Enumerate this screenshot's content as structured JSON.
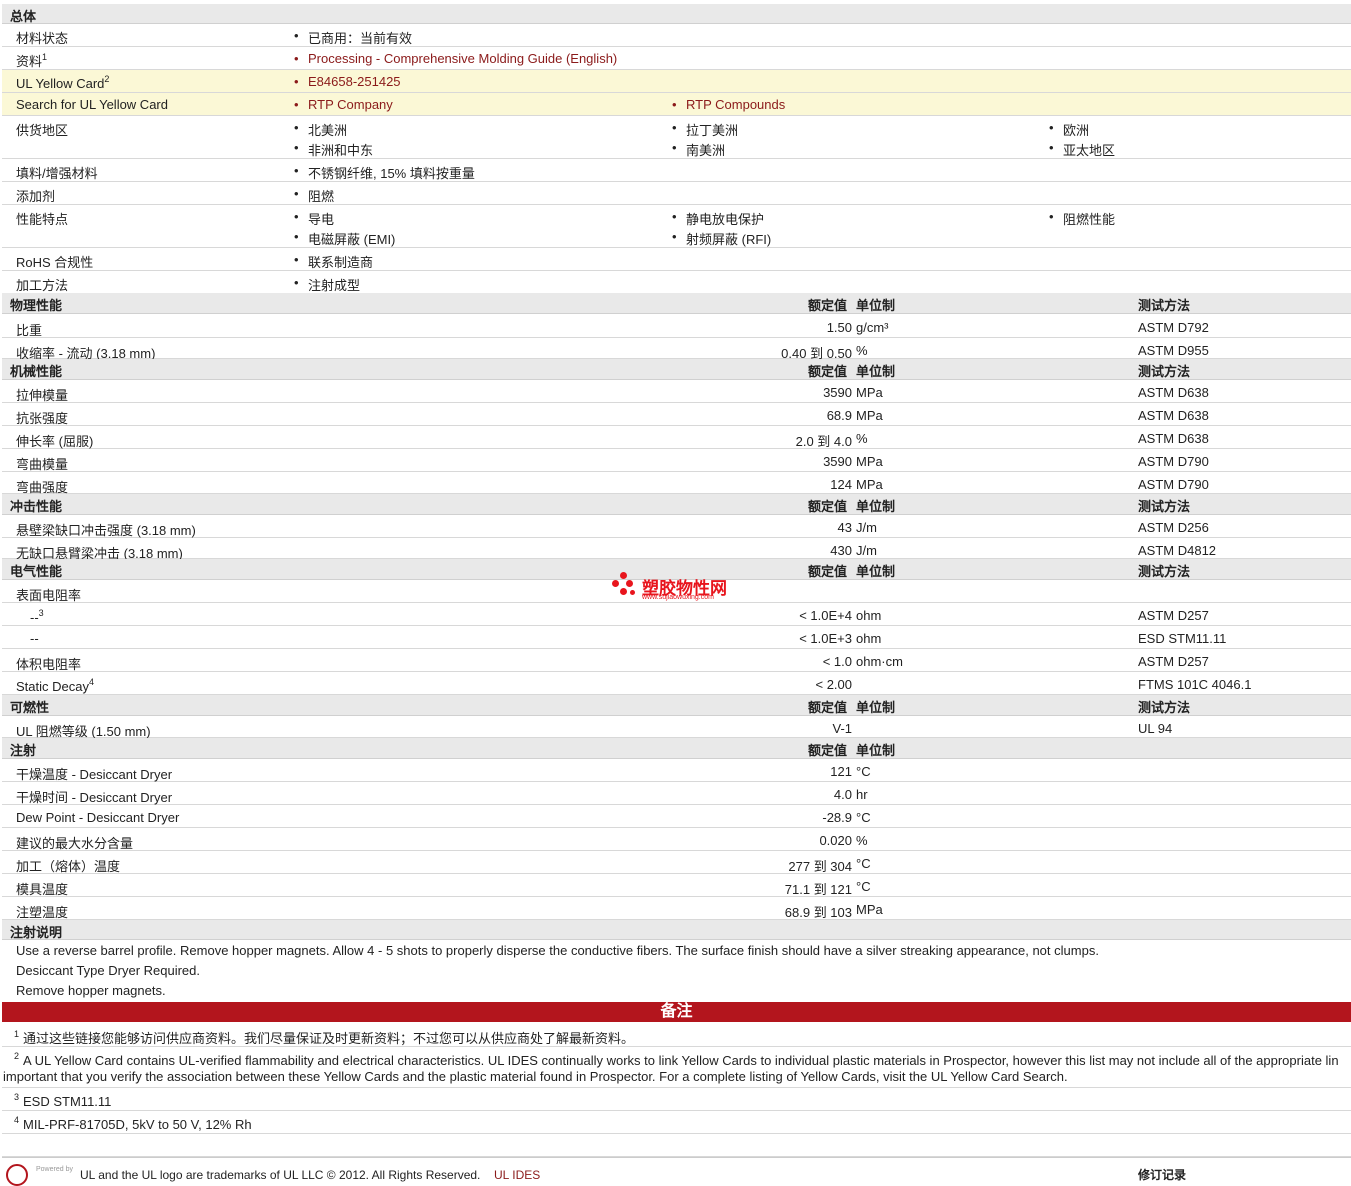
{
  "general": {
    "title": "总体",
    "rows": [
      {
        "label": "材料状态",
        "items": [
          "已商用：当前有效"
        ]
      },
      {
        "label": "资料",
        "sup": "1",
        "items": [
          "Processing - Comprehensive Molding Guide (English)"
        ],
        "link": true
      },
      {
        "label": "UL Yellow Card",
        "sup": "2",
        "items": [
          "E84658-251425"
        ],
        "link": true,
        "highlight": true
      },
      {
        "label": "Search for UL Yellow Card",
        "items": [
          "RTP Company",
          "RTP Compounds"
        ],
        "link": true,
        "highlight": true
      },
      {
        "label": "供货地区",
        "items": [
          "北美洲",
          "拉丁美洲",
          "欧洲",
          "非洲和中东",
          "南美洲",
          "亚太地区"
        ]
      },
      {
        "label": "填料/增强材料",
        "items": [
          "不锈钢纤维, 15% 填料按重量"
        ]
      },
      {
        "label": "添加剂",
        "items": [
          "阻燃"
        ]
      },
      {
        "label": "性能特点",
        "items": [
          "导电",
          "静电放电保护",
          "阻燃性能",
          "电磁屏蔽 (EMI)",
          "射频屏蔽 (RFI)"
        ]
      },
      {
        "label": "RoHS 合规性",
        "items": [
          "联系制造商"
        ]
      },
      {
        "label": "加工方法",
        "items": [
          "注射成型"
        ]
      }
    ]
  },
  "columns": {
    "value": "额定值",
    "unit": "单位制",
    "method": "测试方法"
  },
  "sections": [
    {
      "title": "物理性能",
      "rows": [
        {
          "label": "比重",
          "value": "1.50",
          "unit": "g/cm³",
          "method": "ASTM D792"
        },
        {
          "label": "收缩率 - 流动 (3.18 mm)",
          "value": "0.40 到  0.50",
          "unit": "%",
          "method": "ASTM D955"
        }
      ]
    },
    {
      "title": "机械性能",
      "rows": [
        {
          "label": "拉伸模量",
          "value": "3590",
          "unit": "MPa",
          "method": "ASTM D638"
        },
        {
          "label": "抗张强度",
          "value": "68.9",
          "unit": "MPa",
          "method": "ASTM D638"
        },
        {
          "label": "伸长率 (屈服)",
          "value": "2.0 到  4.0",
          "unit": "%",
          "method": "ASTM D638"
        },
        {
          "label": "弯曲模量",
          "value": "3590",
          "unit": "MPa",
          "method": "ASTM D790"
        },
        {
          "label": "弯曲强度",
          "value": "124",
          "unit": "MPa",
          "method": "ASTM D790"
        }
      ]
    },
    {
      "title": "冲击性能",
      "rows": [
        {
          "label": "悬壁梁缺口冲击强度 (3.18 mm)",
          "value": "43",
          "unit": "J/m",
          "method": "ASTM D256"
        },
        {
          "label": "无缺口悬臂梁冲击 (3.18 mm)",
          "value": "430",
          "unit": "J/m",
          "method": "ASTM D4812"
        }
      ]
    },
    {
      "title": "电气性能",
      "rows": [
        {
          "label": "表面电阻率",
          "value": "",
          "unit": "",
          "method": ""
        },
        {
          "label": "--",
          "sup": "3",
          "indent": true,
          "value": "< 1.0E+4",
          "unit": "ohm",
          "method": "ASTM D257"
        },
        {
          "label": "--",
          "indent": true,
          "value": "< 1.0E+3",
          "unit": "ohm",
          "method": "ESD STM11.11"
        },
        {
          "label": "体积电阻率",
          "value": "< 1.0",
          "unit": "ohm·cm",
          "method": "ASTM D257"
        },
        {
          "label": "Static Decay",
          "sup": "4",
          "value": "< 2.00",
          "unit": "",
          "method": "FTMS 101C 4046.1"
        }
      ]
    },
    {
      "title": "可燃性",
      "rows": [
        {
          "label": "UL 阻燃等级 (1.50 mm)",
          "value": "V-1",
          "unit": "",
          "method": "UL 94"
        }
      ]
    },
    {
      "title": "注射",
      "noMethod": true,
      "rows": [
        {
          "label": "干燥温度 - Desiccant Dryer",
          "value": "121",
          "unit": "°C",
          "method": ""
        },
        {
          "label": "干燥时间 - Desiccant Dryer",
          "value": "4.0",
          "unit": "hr",
          "method": ""
        },
        {
          "label": "Dew Point - Desiccant Dryer",
          "value": "-28.9",
          "unit": "°C",
          "method": ""
        },
        {
          "label": "建议的最大水分含量",
          "value": "0.020",
          "unit": "%",
          "method": ""
        },
        {
          "label": "加工（熔体）温度",
          "value": "277 到  304",
          "unit": "°C",
          "method": ""
        },
        {
          "label": "模具温度",
          "value": "71.1 到  121",
          "unit": "°C",
          "method": ""
        },
        {
          "label": "注塑温度",
          "value": "68.9 到  103",
          "unit": "MPa",
          "method": ""
        }
      ]
    }
  ],
  "injection_notes": {
    "title": "注射说明",
    "lines": [
      "Use a reverse barrel profile. Remove hopper magnets. Allow 4 - 5 shots to properly disperse the conductive fibers. The surface finish should have a silver streaking appearance, not clumps.",
      "Desiccant Type Dryer Required.",
      "Remove hopper magnets."
    ]
  },
  "notes": {
    "title": "备注",
    "items": [
      {
        "num": "1",
        "text": "通过这些链接您能够访问供应商资料。我们尽量保证及时更新资料；不过您可以从供应商处了解最新资料。"
      },
      {
        "num": "2",
        "text": "A UL Yellow Card contains UL-verified flammability and electrical characteristics. UL IDES continually works to link Yellow Cards to individual plastic materials in Prospector, however this list may not include all of the appropriate lin",
        "text2": "important that you verify the association between these Yellow Cards and the plastic material found in Prospector. For a complete listing of Yellow Cards, visit the UL Yellow Card Search."
      },
      {
        "num": "3",
        "text": "ESD STM11.11"
      },
      {
        "num": "4",
        "text": "MIL-PRF-81705D, 5kV to 50 V, 12% Rh"
      }
    ]
  },
  "footer": {
    "powered": "Powered by",
    "text": "UL and the UL logo are trademarks of UL LLC © 2012. All Rights Reserved.",
    "link": "UL IDES",
    "right": "修订记录"
  },
  "watermark": {
    "text": "塑胶物性网",
    "url": "www.sujiaowuxing.com"
  },
  "colors": {
    "accent": "#b3151d",
    "link": "#8b1a1a",
    "highlight": "#fbf8d6",
    "section": "#e9e9e9"
  }
}
